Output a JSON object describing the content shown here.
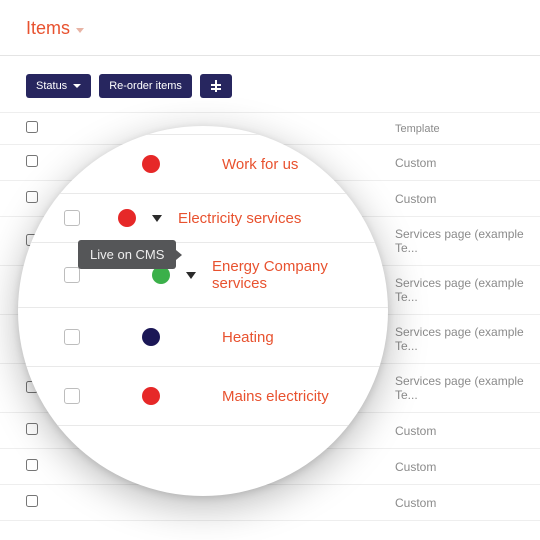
{
  "header": {
    "title": "Items"
  },
  "toolbar": {
    "status_label": "Status",
    "reorder_label": "Re-order items"
  },
  "table": {
    "template_header": "Template",
    "bg_rows": [
      {
        "template": "Custom"
      },
      {
        "template": "Custom"
      },
      {
        "template": "Services page (example Te..."
      },
      {
        "template": "Services page (example Te..."
      },
      {
        "template": "Services page (example Te..."
      },
      {
        "template": "Services page (example Te..."
      },
      {
        "template": "Custom"
      },
      {
        "template": "Custom"
      },
      {
        "template": "Custom"
      }
    ]
  },
  "lens_rows": [
    {
      "status": "red",
      "expand": false,
      "name": "Work for us",
      "indent": 0
    },
    {
      "status": "red",
      "expand": true,
      "name": "Electricity services",
      "indent": 0
    },
    {
      "status": "green",
      "expand": true,
      "name": "Energy Company services",
      "indent": 1
    },
    {
      "status": "navy",
      "expand": false,
      "name": "Heating",
      "indent": 0
    },
    {
      "status": "red",
      "expand": false,
      "name": "Mains electricity",
      "indent": 0
    }
  ],
  "tooltip": "Live on CMS",
  "colors": {
    "accent": "#e8522f",
    "primary_btn": "#27265f",
    "status_red": "#e62828",
    "status_green": "#3bb04a",
    "status_navy": "#1b1756"
  }
}
